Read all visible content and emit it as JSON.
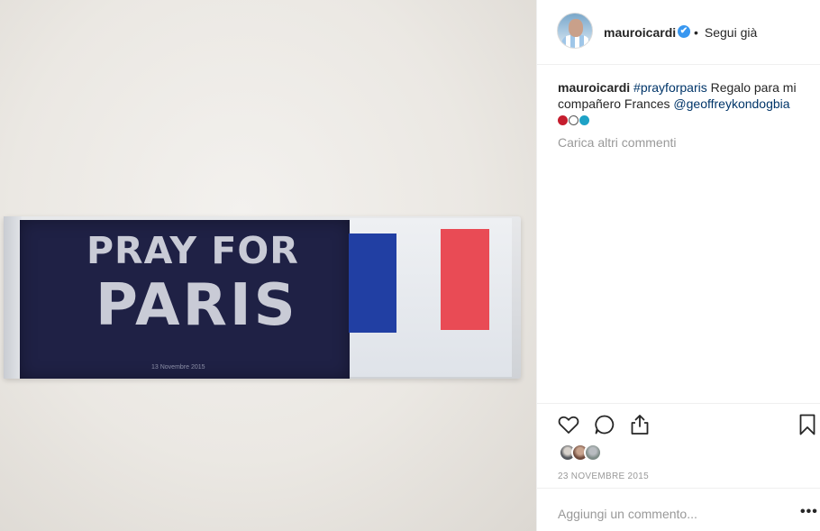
{
  "photo": {
    "armband_text_line1": "PRAY FOR",
    "armband_text_line2": "PARIS",
    "armband_date": "13 Novembre 2015",
    "colors": {
      "navy": "#1f2145",
      "flag_blue": "#213fa3",
      "flag_red": "#e94b55"
    }
  },
  "header": {
    "username": "mauroicardi",
    "verified_icon": "✔",
    "separator": "•",
    "follow_label": "Segui già"
  },
  "caption": {
    "username": "mauroicardi",
    "hashtag": "#prayforparis",
    "text": " Regalo para mi compañero Frances ",
    "mention": "@geoffreykondogbia",
    "emojis": [
      "red-circle",
      "white-circle",
      "blue-circle"
    ]
  },
  "comments": {
    "load_more_label": "Carica altri commenti"
  },
  "actions": {
    "icons": [
      "heart-icon",
      "comment-icon",
      "share-icon",
      "bookmark-icon"
    ]
  },
  "post": {
    "date": "23 NOVEMBRE 2015"
  },
  "comment_input": {
    "placeholder": "Aggiungi un commento...",
    "more_label": "•••"
  }
}
